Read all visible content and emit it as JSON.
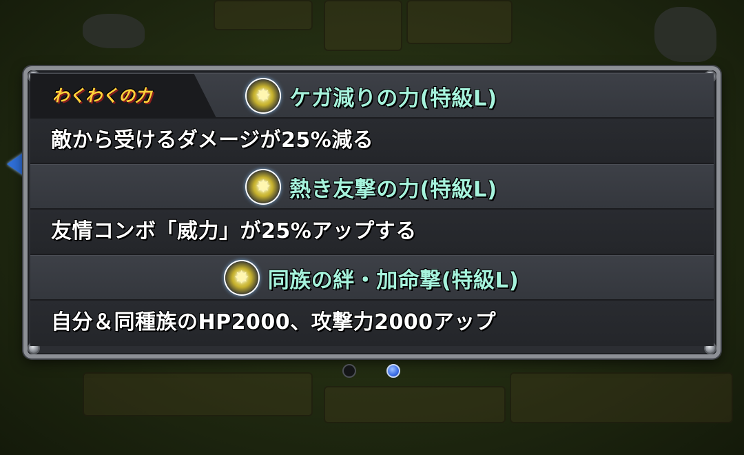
{
  "panel": {
    "tag_label": "わくわくの力",
    "abilities": [
      {
        "title": "ケガ減りの力(特級L)",
        "description": "敵から受けるダメージが25%減る",
        "icon": "sparkle-orb-icon"
      },
      {
        "title": "熱き友撃の力(特級L)",
        "description": "友情コンボ「威力」が25%アップする",
        "icon": "sparkle-orb-icon"
      },
      {
        "title": "同族の絆・加命撃(特級L)",
        "description": "自分＆同種族のHP2000、攻撃力2000アップ",
        "icon": "sparkle-orb-icon"
      }
    ]
  },
  "pager": {
    "total": 2,
    "current": 2
  },
  "colors": {
    "title": "#a6f3dc",
    "accent_blue": "#2f6fd8",
    "tag_text": "#ffd23a"
  }
}
